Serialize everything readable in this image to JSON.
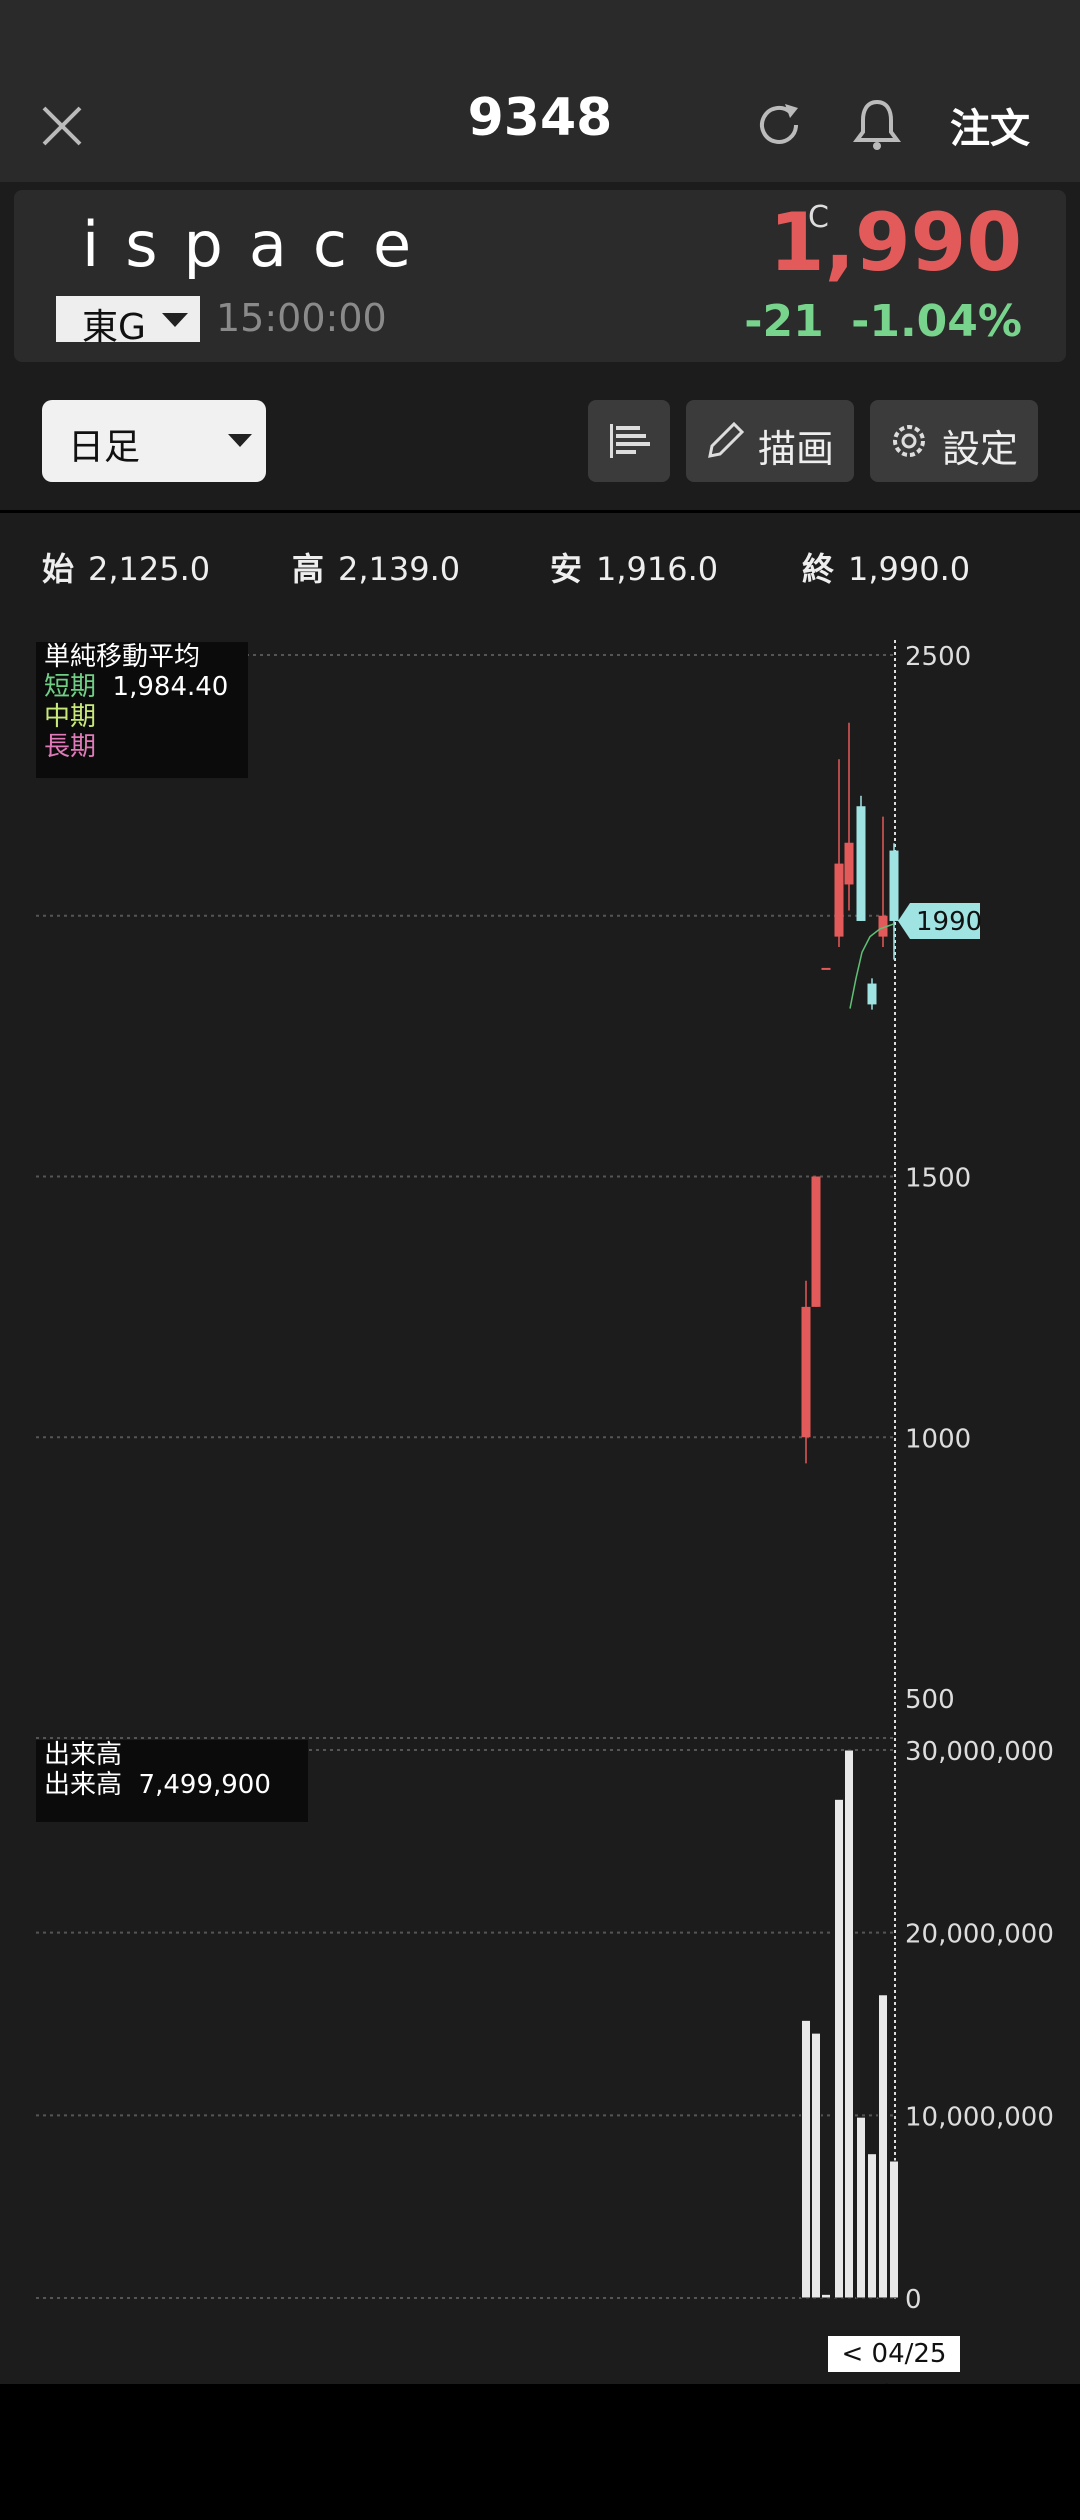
{
  "header": {
    "ticker": "9348",
    "order_label": "注文"
  },
  "quote": {
    "company": "ispace",
    "market": "東G",
    "time": "15:00:00",
    "close_marker": "C",
    "price": "1,990",
    "change": "-21  -1.04%",
    "price_color": "#e35a5a",
    "change_color": "#78d48c"
  },
  "toolbar": {
    "period": "日足",
    "draw_label": "描画",
    "settings_label": "設定"
  },
  "ohlc": [
    {
      "key": "始",
      "val": "2,125.0"
    },
    {
      "key": "高",
      "val": "2,139.0"
    },
    {
      "key": "安",
      "val": "1,916.0"
    },
    {
      "key": "終",
      "val": "1,990.0"
    }
  ],
  "sma_legend": {
    "title": "単純移動平均",
    "short_label": "短期",
    "short_value": "1,984.40",
    "mid_label": "中期",
    "long_label": "長期"
  },
  "volume_legend": {
    "title": "出来高",
    "label": "出来高",
    "value": "7,499,900"
  },
  "date_tag": "< 04/25 >",
  "chart_data": {
    "type": "candlestick",
    "price_axis": {
      "ticks": [
        2500,
        1500,
        1000,
        500
      ],
      "ylim": [
        500,
        2500
      ]
    },
    "last_price_label": "1990",
    "candles": [
      {
        "open": 1000,
        "high": 1300,
        "low": 950,
        "close": 1250
      },
      {
        "open": 1250,
        "high": 1500,
        "low": 1250,
        "close": 1500
      },
      {
        "open": 1900,
        "high": 1900,
        "low": 1900,
        "close": 1900
      },
      {
        "open": 1960,
        "high": 2300,
        "low": 1940,
        "close": 2100
      },
      {
        "open": 2060,
        "high": 2370,
        "low": 2010,
        "close": 2140
      },
      {
        "open": 2210,
        "high": 2230,
        "low": 1990,
        "close": 1990
      },
      {
        "open": 1870,
        "high": 1880,
        "low": 1820,
        "close": 1830
      },
      {
        "open": 1960,
        "high": 2190,
        "low": 1940,
        "close": 2000
      },
      {
        "open": 2125,
        "high": 2139,
        "low": 1916,
        "close": 1990
      }
    ],
    "volume_axis": {
      "ticks": [
        "30,000,000",
        "20,000,000",
        "10,000,000",
        "0"
      ],
      "ylim": [
        0,
        30000000
      ]
    },
    "volumes": [
      15200000,
      14500000,
      200000,
      27300000,
      30000000,
      9900000,
      7900000,
      16600000,
      7499900
    ],
    "colors": {
      "up": "#e35a5a",
      "down": "#9fe3e3",
      "sma_short": "#5fbf75",
      "volume": "#e8e8e8"
    }
  }
}
